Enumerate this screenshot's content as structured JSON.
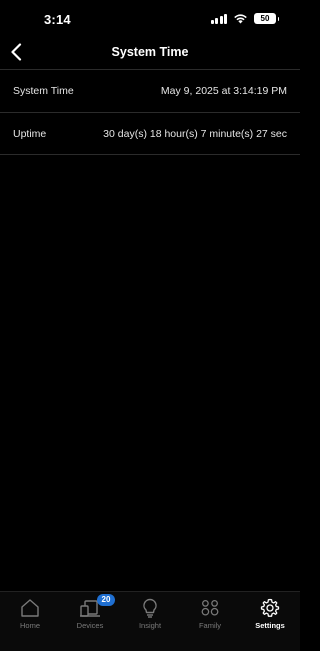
{
  "status_bar": {
    "time": "3:14",
    "battery": "50"
  },
  "header": {
    "title": "System Time"
  },
  "rows": [
    {
      "label": "System Time",
      "value": "May 9, 2025 at 3:14:19 PM"
    },
    {
      "label": "Uptime",
      "value": "30 day(s) 18 hour(s) 7 minute(s) 27 sec"
    }
  ],
  "tabs": [
    {
      "label": "Home",
      "icon": "home-icon",
      "active": false
    },
    {
      "label": "Devices",
      "icon": "devices-icon",
      "active": false,
      "badge": "20"
    },
    {
      "label": "Insight",
      "icon": "lightbulb-icon",
      "active": false
    },
    {
      "label": "Family",
      "icon": "family-icon",
      "active": false
    },
    {
      "label": "Settings",
      "icon": "gear-icon",
      "active": true
    }
  ],
  "colors": {
    "background": "#000000",
    "badge": "#1f6fd1",
    "inactive_tab": "#7a7a7a",
    "divider": "#2b2b2b"
  }
}
